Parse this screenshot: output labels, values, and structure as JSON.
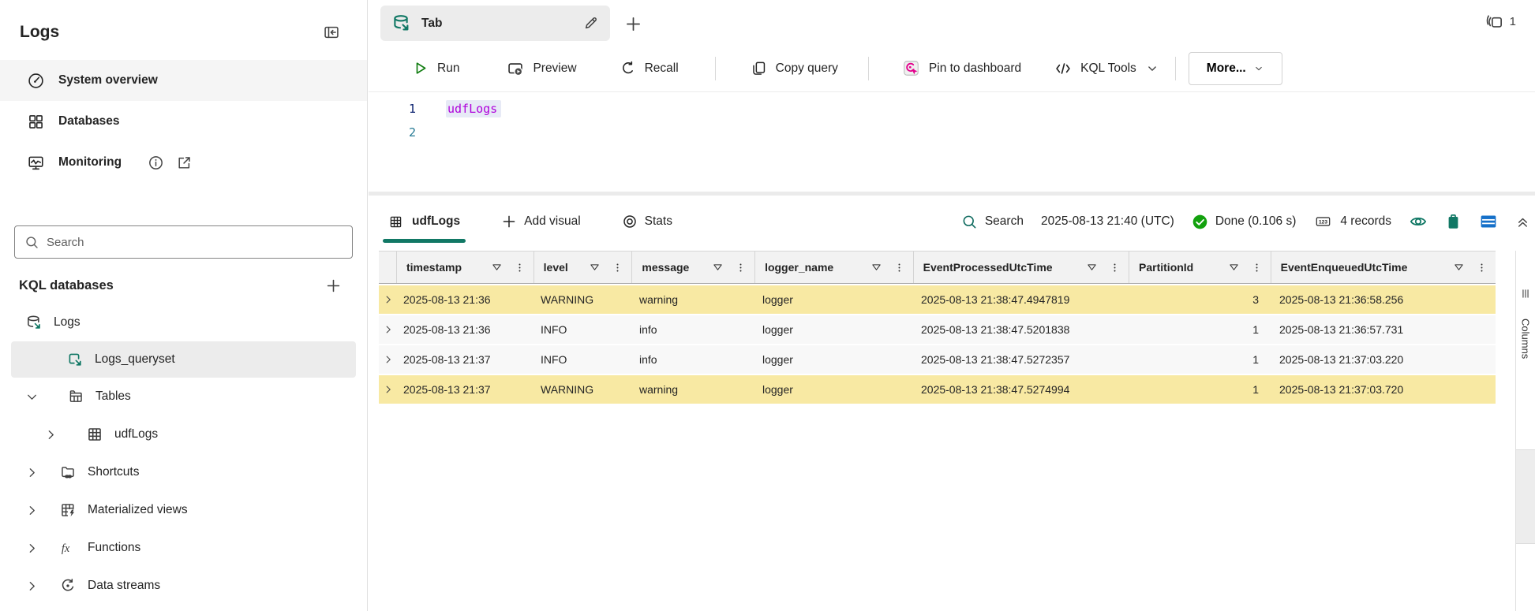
{
  "sidebar": {
    "title": "Logs",
    "nav": [
      {
        "label": "System overview",
        "icon": "speedometer-icon",
        "active": true
      },
      {
        "label": "Databases",
        "icon": "grid-squares-icon"
      },
      {
        "label": "Monitoring",
        "icon": "monitor-pulse-icon",
        "trailing_icons": [
          "info-icon",
          "open-external-icon"
        ]
      }
    ],
    "search": {
      "placeholder": "Search"
    },
    "databases_section": {
      "title": "KQL databases"
    },
    "tree": [
      {
        "label": "Logs",
        "icon": "kql-database-icon",
        "depth": 0
      },
      {
        "label": "Logs_queryset",
        "icon": "queryset-icon",
        "depth": 1,
        "selected": true
      },
      {
        "label": "Tables",
        "icon": "folder-table-icon",
        "depth": 1,
        "expanded": true
      },
      {
        "label": "udfLogs",
        "icon": "table-icon",
        "depth": 2
      },
      {
        "label": "Shortcuts",
        "icon": "folder-shortcut-icon",
        "depth": 1
      },
      {
        "label": "Materialized views",
        "icon": "materialized-view-icon",
        "depth": 1
      },
      {
        "label": "Functions",
        "icon": "function-icon",
        "depth": 1
      },
      {
        "label": "Data streams",
        "icon": "data-stream-icon",
        "depth": 1
      }
    ]
  },
  "tabbar": {
    "tab_label": "Tab",
    "open_tabs_count": "1"
  },
  "toolbar": {
    "run": "Run",
    "preview": "Preview",
    "recall": "Recall",
    "copy_query": "Copy query",
    "pin_to_dashboard": "Pin to dashboard",
    "kql_tools": "KQL Tools",
    "more": "More..."
  },
  "editor": {
    "lines": [
      {
        "number": "1",
        "code": "udfLogs"
      },
      {
        "number": "2",
        "code": ""
      }
    ]
  },
  "results": {
    "table_tab": "udfLogs",
    "add_visual": "Add visual",
    "stats": "Stats",
    "search_label": "Search",
    "query_time": "2025-08-13 21:40 (UTC)",
    "status": "Done (0.106 s)",
    "records_badge": "123",
    "records": "4 records",
    "columns_panel_label": "Columns"
  },
  "grid": {
    "columns": [
      {
        "label": "timestamp"
      },
      {
        "label": "level"
      },
      {
        "label": "message"
      },
      {
        "label": "logger_name"
      },
      {
        "label": "EventProcessedUtcTime"
      },
      {
        "label": "PartitionId"
      },
      {
        "label": "EventEnqueuedUtcTime"
      }
    ],
    "rows": [
      {
        "highlight": true,
        "cells": [
          "2025-08-13 21:36",
          "WARNING",
          "warning",
          "logger",
          "2025-08-13 21:38:47.4947819",
          "3",
          "2025-08-13 21:36:58.256"
        ]
      },
      {
        "highlight": false,
        "cells": [
          "2025-08-13 21:36",
          "INFO",
          "info",
          "logger",
          "2025-08-13 21:38:47.5201838",
          "1",
          "2025-08-13 21:36:57.731"
        ]
      },
      {
        "highlight": false,
        "cells": [
          "2025-08-13 21:37",
          "INFO",
          "info",
          "logger",
          "2025-08-13 21:38:47.5272357",
          "1",
          "2025-08-13 21:37:03.220"
        ]
      },
      {
        "highlight": true,
        "cells": [
          "2025-08-13 21:37",
          "WARNING",
          "warning",
          "logger",
          "2025-08-13 21:38:47.5274994",
          "1",
          "2025-08-13 21:37:03.720"
        ]
      }
    ]
  },
  "colors": {
    "accent_teal": "#117865",
    "run_green": "#107C10",
    "status_green": "#13A10E",
    "pin_magenta": "#E3008C",
    "table_icon_blue": "#1570C9",
    "row_highlight": "#F8E9A3",
    "code_keyword": "#AF00DB",
    "line_number": "#237893",
    "line_number_active": "#0B216F"
  }
}
